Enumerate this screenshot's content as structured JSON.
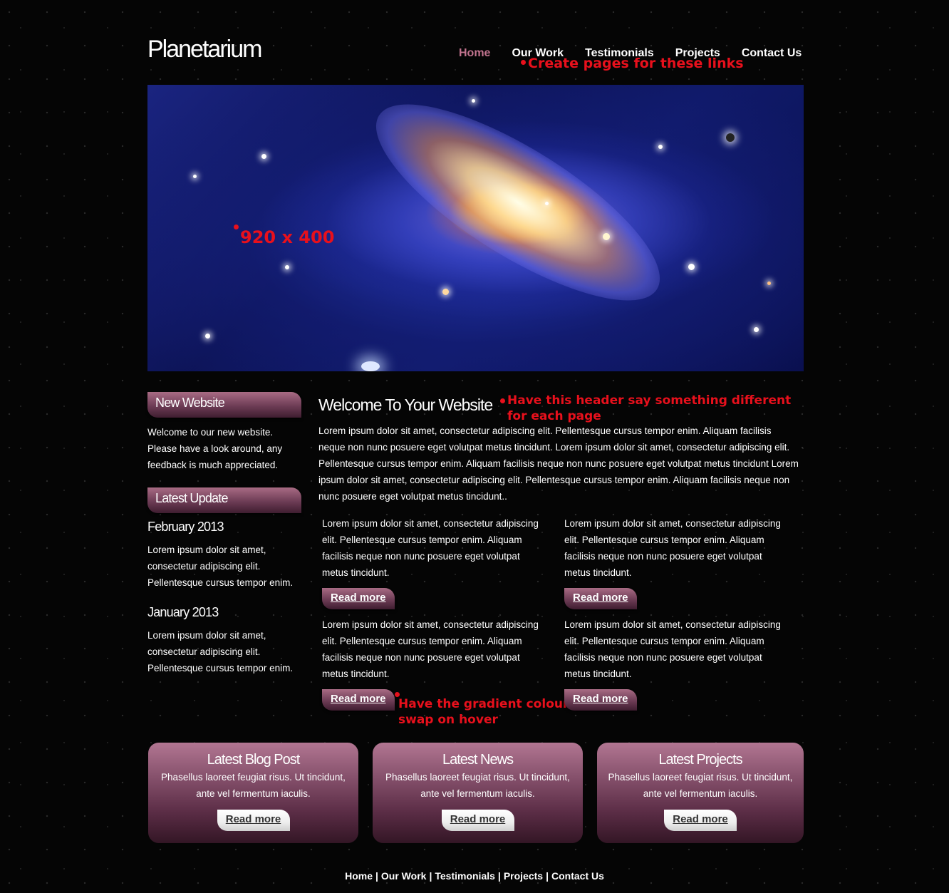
{
  "site": {
    "logo": "Planetarium"
  },
  "nav": {
    "items": [
      {
        "label": "Home",
        "active": true
      },
      {
        "label": "Our Work"
      },
      {
        "label": "Testimonials"
      },
      {
        "label": "Projects"
      },
      {
        "label": "Contact Us"
      }
    ],
    "active_color": "#c2748f"
  },
  "notes": {
    "nav_note": "Create pages for these links",
    "hero_size": "920 x 400",
    "header_note_line1": "Have this header say something different",
    "header_note_line2": "for each page",
    "hover_note_line1": "Have the gradient colours",
    "hover_note_line2": "swap on hover",
    "color": "#e8101c"
  },
  "sidebar": {
    "new_website": {
      "heading": "New Website",
      "lines": [
        "Welcome to our new website.",
        "Please have a look around, any",
        "feedback is much appreciated."
      ]
    },
    "latest_update": {
      "heading": "Latest Update",
      "entries": [
        {
          "date": "February 2013",
          "lines": [
            "Lorem ipsum dolor sit amet,",
            "consectetur adipiscing elit.",
            "Pellentesque cursus tempor enim."
          ]
        },
        {
          "date": "January 2013",
          "lines": [
            "Lorem ipsum dolor sit amet,",
            "consectetur adipiscing elit.",
            "Pellentesque cursus tempor enim."
          ]
        }
      ]
    }
  },
  "main": {
    "heading": "Welcome To Your Website",
    "intro_lines": [
      "Lorem ipsum dolor sit amet, consectetur adipiscing elit. Pellentesque cursus tempor enim. Aliquam facilisis",
      "neque non nunc posuere eget volutpat metus tincidunt. Lorem ipsum dolor sit amet, consectetur adipiscing elit.",
      "Pellentesque cursus tempor enim. Aliquam facilisis neque non nunc posuere eget volutpat metus tincidunt Lorem",
      "ipsum dolor sit amet, consectetur adipiscing elit. Pellentesque cursus tempor enim. Aliquam facilisis neque non",
      "nunc posuere eget volutpat metus tincidunt.."
    ],
    "columns": [
      {
        "lines": [
          "Lorem ipsum dolor sit amet, consectetur adipiscing",
          "elit. Pellentesque cursus tempor enim. Aliquam",
          "facilisis neque non nunc posuere eget volutpat",
          "metus tincidunt."
        ],
        "button": "Read more"
      },
      {
        "lines": [
          "Lorem ipsum dolor sit amet, consectetur adipiscing",
          "elit. Pellentesque cursus tempor enim. Aliquam",
          "facilisis neque non nunc posuere eget volutpat",
          "metus tincidunt."
        ],
        "button": "Read more"
      },
      {
        "lines": [
          "Lorem ipsum dolor sit amet, consectetur adipiscing",
          "elit. Pellentesque cursus tempor enim. Aliquam",
          "facilisis neque non nunc posuere eget volutpat",
          "metus tincidunt."
        ],
        "button": "Read more"
      },
      {
        "lines": [
          "Lorem ipsum dolor sit amet, consectetur adipiscing",
          "elit. Pellentesque cursus tempor enim. Aliquam",
          "facilisis neque non nunc posuere eget volutpat",
          "metus tincidunt."
        ],
        "button": "Read more"
      }
    ]
  },
  "boxes": [
    {
      "title": "Latest Blog Post",
      "lines": [
        "Phasellus laoreet feugiat risus. Ut tincidunt,",
        "ante vel fermentum iaculis."
      ],
      "button": "Read more"
    },
    {
      "title": "Latest News",
      "lines": [
        "Phasellus laoreet feugiat risus. Ut tincidunt,",
        "ante vel fermentum iaculis."
      ],
      "button": "Read more"
    },
    {
      "title": "Latest Projects",
      "lines": [
        "Phasellus laoreet feugiat risus. Ut tincidunt,",
        "ante vel fermentum iaculis."
      ],
      "button": "Read more"
    }
  ],
  "footer": {
    "links": [
      "Home",
      "Our Work",
      "Testimonials",
      "Projects",
      "Contact Us"
    ],
    "separator": "|"
  },
  "colors": {
    "gradient_top": "#a86b84",
    "gradient_bottom": "#3f1d30",
    "background": "#050505"
  }
}
